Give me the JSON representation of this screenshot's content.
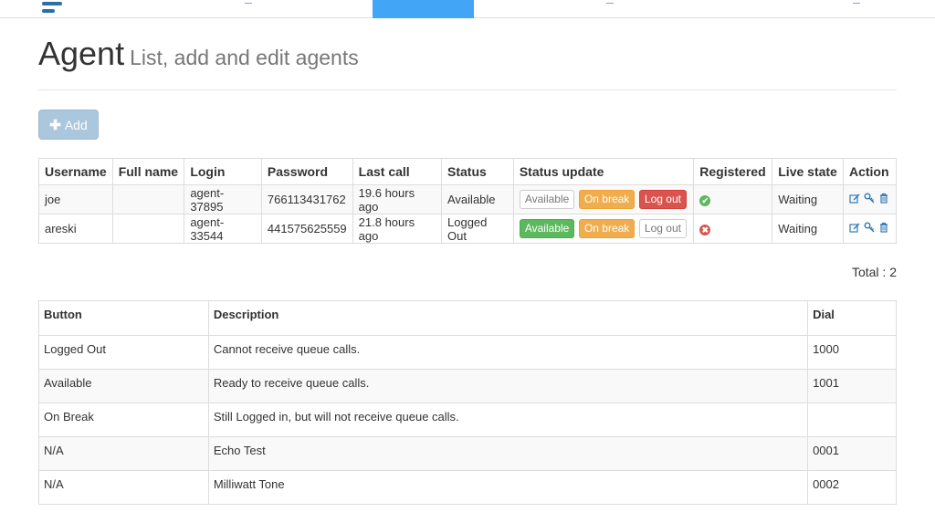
{
  "header": {
    "title": "Agent",
    "subtitle": "List, add and edit agents"
  },
  "toolbar": {
    "add_label": "Add",
    "add_icon": "plus-icon"
  },
  "agents_table": {
    "columns": [
      "Username",
      "Full name",
      "Login",
      "Password",
      "Last call",
      "Status",
      "Status update",
      "Registered",
      "Live state",
      "Action"
    ],
    "rows": [
      {
        "username": "joe",
        "full_name": "",
        "login": "agent-37895",
        "password": "766113431762",
        "last_call": "19.6 hours ago",
        "status": "Available",
        "status_buttons": {
          "available": "Available",
          "on_break": "On break",
          "log_out": "Log out"
        },
        "registered": "ok",
        "live_state": "Waiting"
      },
      {
        "username": "areski",
        "full_name": "",
        "login": "agent-33544",
        "password": "441575625559",
        "last_call": "21.8 hours ago",
        "status": "Logged Out",
        "status_buttons": {
          "available": "Available",
          "on_break": "On break",
          "log_out": "Log out"
        },
        "registered": "error",
        "live_state": "Waiting"
      }
    ],
    "total_label": "Total : 2"
  },
  "buttons_table": {
    "columns": [
      "Button",
      "Description",
      "Dial"
    ],
    "rows": [
      {
        "button": "Logged Out",
        "description": "Cannot receive queue calls.",
        "dial": "1000"
      },
      {
        "button": "Available",
        "description": "Ready to receive queue calls.",
        "dial": "1001"
      },
      {
        "button": "On Break",
        "description": "Still Logged in, but will not receive queue calls.",
        "dial": ""
      },
      {
        "button": "N/A",
        "description": "Echo Test",
        "dial": "0001"
      },
      {
        "button": "N/A",
        "description": "Milliwatt Tone",
        "dial": "0002"
      }
    ]
  },
  "colors": {
    "active_tab": "#42a5f5",
    "success": "#5cb85c",
    "warning": "#f0ad4e",
    "danger": "#d9534f",
    "link": "#337ab7"
  }
}
